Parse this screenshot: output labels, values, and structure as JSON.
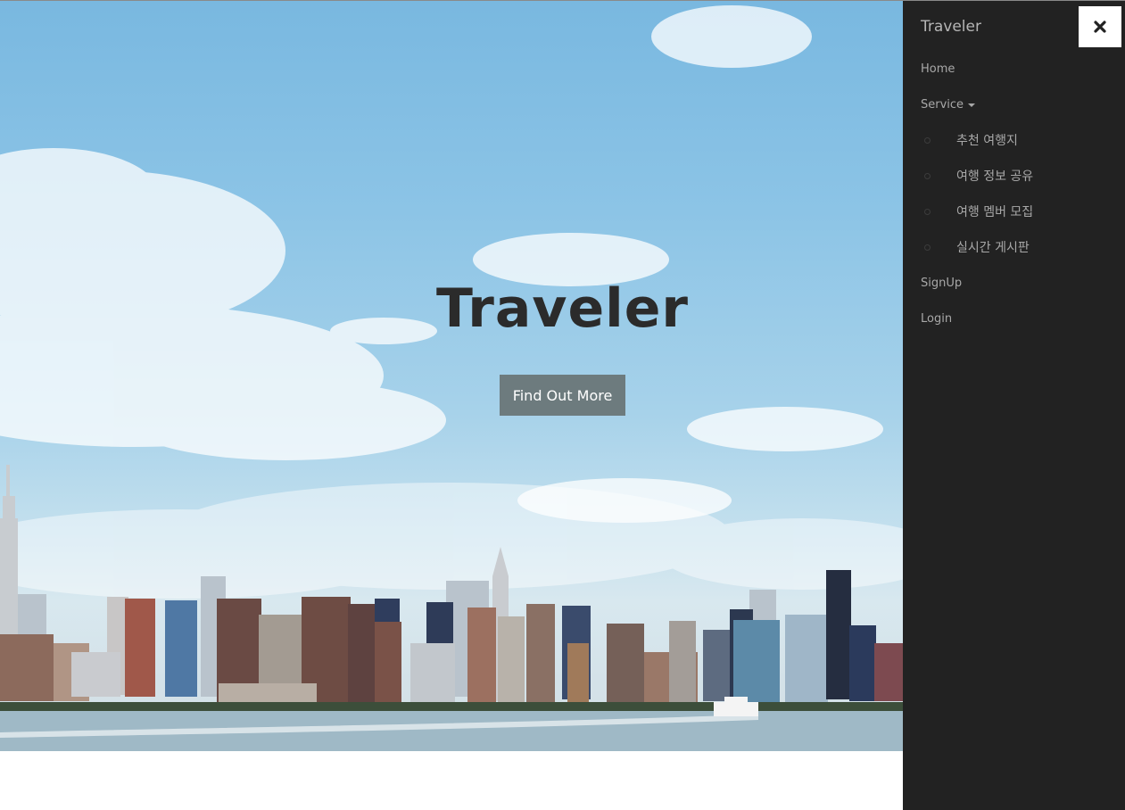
{
  "hero": {
    "title": "Traveler",
    "button_label": "Find Out More"
  },
  "sidebar": {
    "brand": "Traveler",
    "close_icon": "times-icon",
    "items": [
      {
        "label": "Home"
      },
      {
        "label": "Service"
      },
      {
        "label": "SignUp"
      },
      {
        "label": "Login"
      }
    ],
    "service_submenu": [
      {
        "label": "추천 여행지"
      },
      {
        "label": "여행 정보 공유"
      },
      {
        "label": "여행 멤버 모집"
      },
      {
        "label": "실시간 게시판"
      }
    ]
  },
  "colors": {
    "sidebar_bg": "#222222",
    "sidebar_text": "#a8a8a8",
    "button_bg": "#6d7b7e",
    "title_text": "#2b2b2b"
  }
}
